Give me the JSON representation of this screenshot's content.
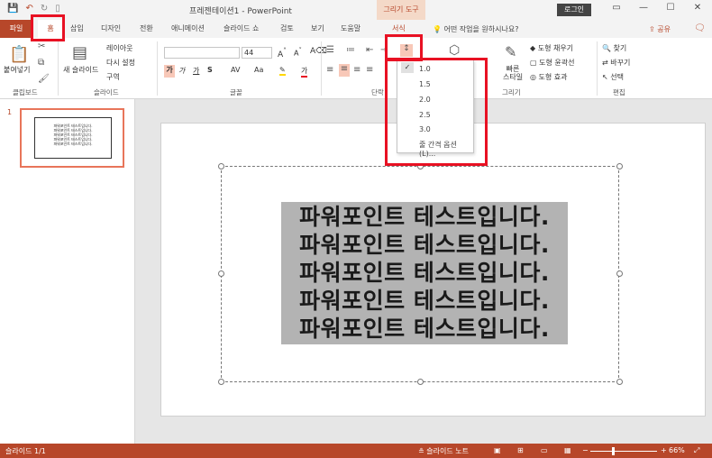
{
  "app": {
    "title": "프레젠테이션1  -  PowerPoint",
    "drawing_tools": "그리기 도구",
    "login": "로그인",
    "share": "공유"
  },
  "qat": {
    "save": "💾",
    "undo": "↶",
    "redo": "↻",
    "start": "▯"
  },
  "window": {
    "restore": "▭",
    "minimize": "—",
    "maximize": "☐",
    "close": "✕"
  },
  "tabs": {
    "file": "파일",
    "home": "홈",
    "insert": "삽입",
    "design": "디자인",
    "transitions": "전환",
    "animations": "애니메이션",
    "slideshow": "슬라이드 쇼",
    "review": "검토",
    "view": "보기",
    "help": "도움말",
    "format": "서식",
    "tellme": "어떤 작업을 원하시나요?"
  },
  "ribbon": {
    "clipboard": {
      "paste": "붙여넣기",
      "label": "클립보드"
    },
    "slides": {
      "new_slide": "새 슬라이드",
      "layout": "레이아웃",
      "reset": "다시 설정",
      "section": "구역",
      "label": "슬라이드"
    },
    "font": {
      "size": "44",
      "label": "글꼴",
      "bold": "가",
      "italic": "가",
      "underline": "가",
      "strike": "S",
      "spacing": "AV",
      "case": "Aa"
    },
    "paragraph": {
      "label": "단락"
    },
    "drawing": {
      "fill": "도형 채우기",
      "outline": "도형 윤곽선",
      "effects": "도형 효과",
      "quick_styles": "빠른\n스타일",
      "label": "그리기"
    },
    "editing": {
      "find": "찾기",
      "replace": "바꾸기",
      "select": "선택",
      "label": "편집"
    }
  },
  "line_spacing_menu": {
    "items": [
      "1.0",
      "1.5",
      "2.0",
      "2.5",
      "3.0"
    ],
    "checked": "1.0",
    "options": "줄 간격 옵션(L)..."
  },
  "thumbnails": {
    "number": "1",
    "lines": [
      "파워포인트 테스트입니다.",
      "파워포인트 테스트입니다.",
      "파워포인트 테스트입니다.",
      "파워포인트 테스트입니다.",
      "파워포인트 테스트입니다."
    ]
  },
  "slide": {
    "lines": [
      "파워포인트 테스트입니다.",
      "파워포인트 테스트입니다.",
      "파워포인트 테스트입니다.",
      "파워포인트 테스트입니다.",
      "파워포인트 테스트입니다."
    ]
  },
  "status": {
    "slide_count": "슬라이드 1/1",
    "notes": "슬라이드 노트",
    "zoom": "66%",
    "zoom_minus": "−",
    "zoom_plus": "+"
  },
  "colors": {
    "accent": "#b7472a",
    "highlight": "#e81123",
    "selection": "#b3b3b3"
  }
}
